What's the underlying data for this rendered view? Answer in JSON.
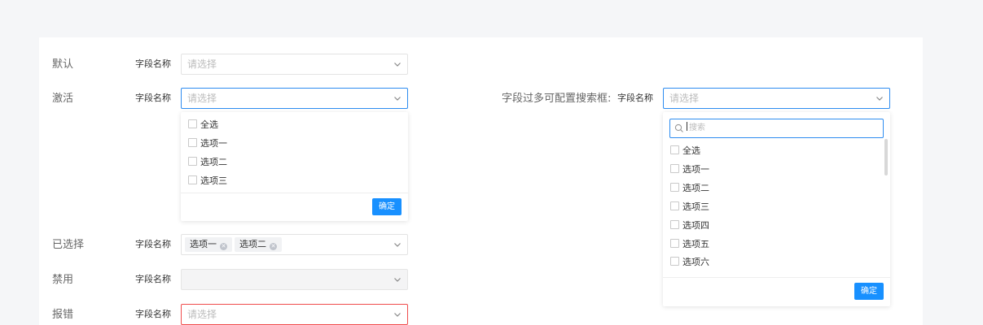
{
  "field_name": "字段名称",
  "placeholder": "请选择",
  "confirm_label": "确定",
  "rows": {
    "default": {
      "label": "默认"
    },
    "active": {
      "label": "激活"
    },
    "selected": {
      "label": "已选择",
      "tags": [
        "选项一",
        "选项二"
      ]
    },
    "disabled": {
      "label": "禁用"
    },
    "error": {
      "label": "报错"
    }
  },
  "dropdown_small": {
    "options": [
      "全选",
      "选项一",
      "选项二",
      "选项三"
    ]
  },
  "search_section": {
    "label": "字段过多可配置搜索框:",
    "search_placeholder": "搜索",
    "options": [
      "全选",
      "选项一",
      "选项二",
      "选项三",
      "选项四",
      "选项五",
      "选项六"
    ]
  },
  "colors": {
    "accent": "#1890ff",
    "active_border": "#2d8cf0",
    "error_border": "#f04c4c"
  }
}
